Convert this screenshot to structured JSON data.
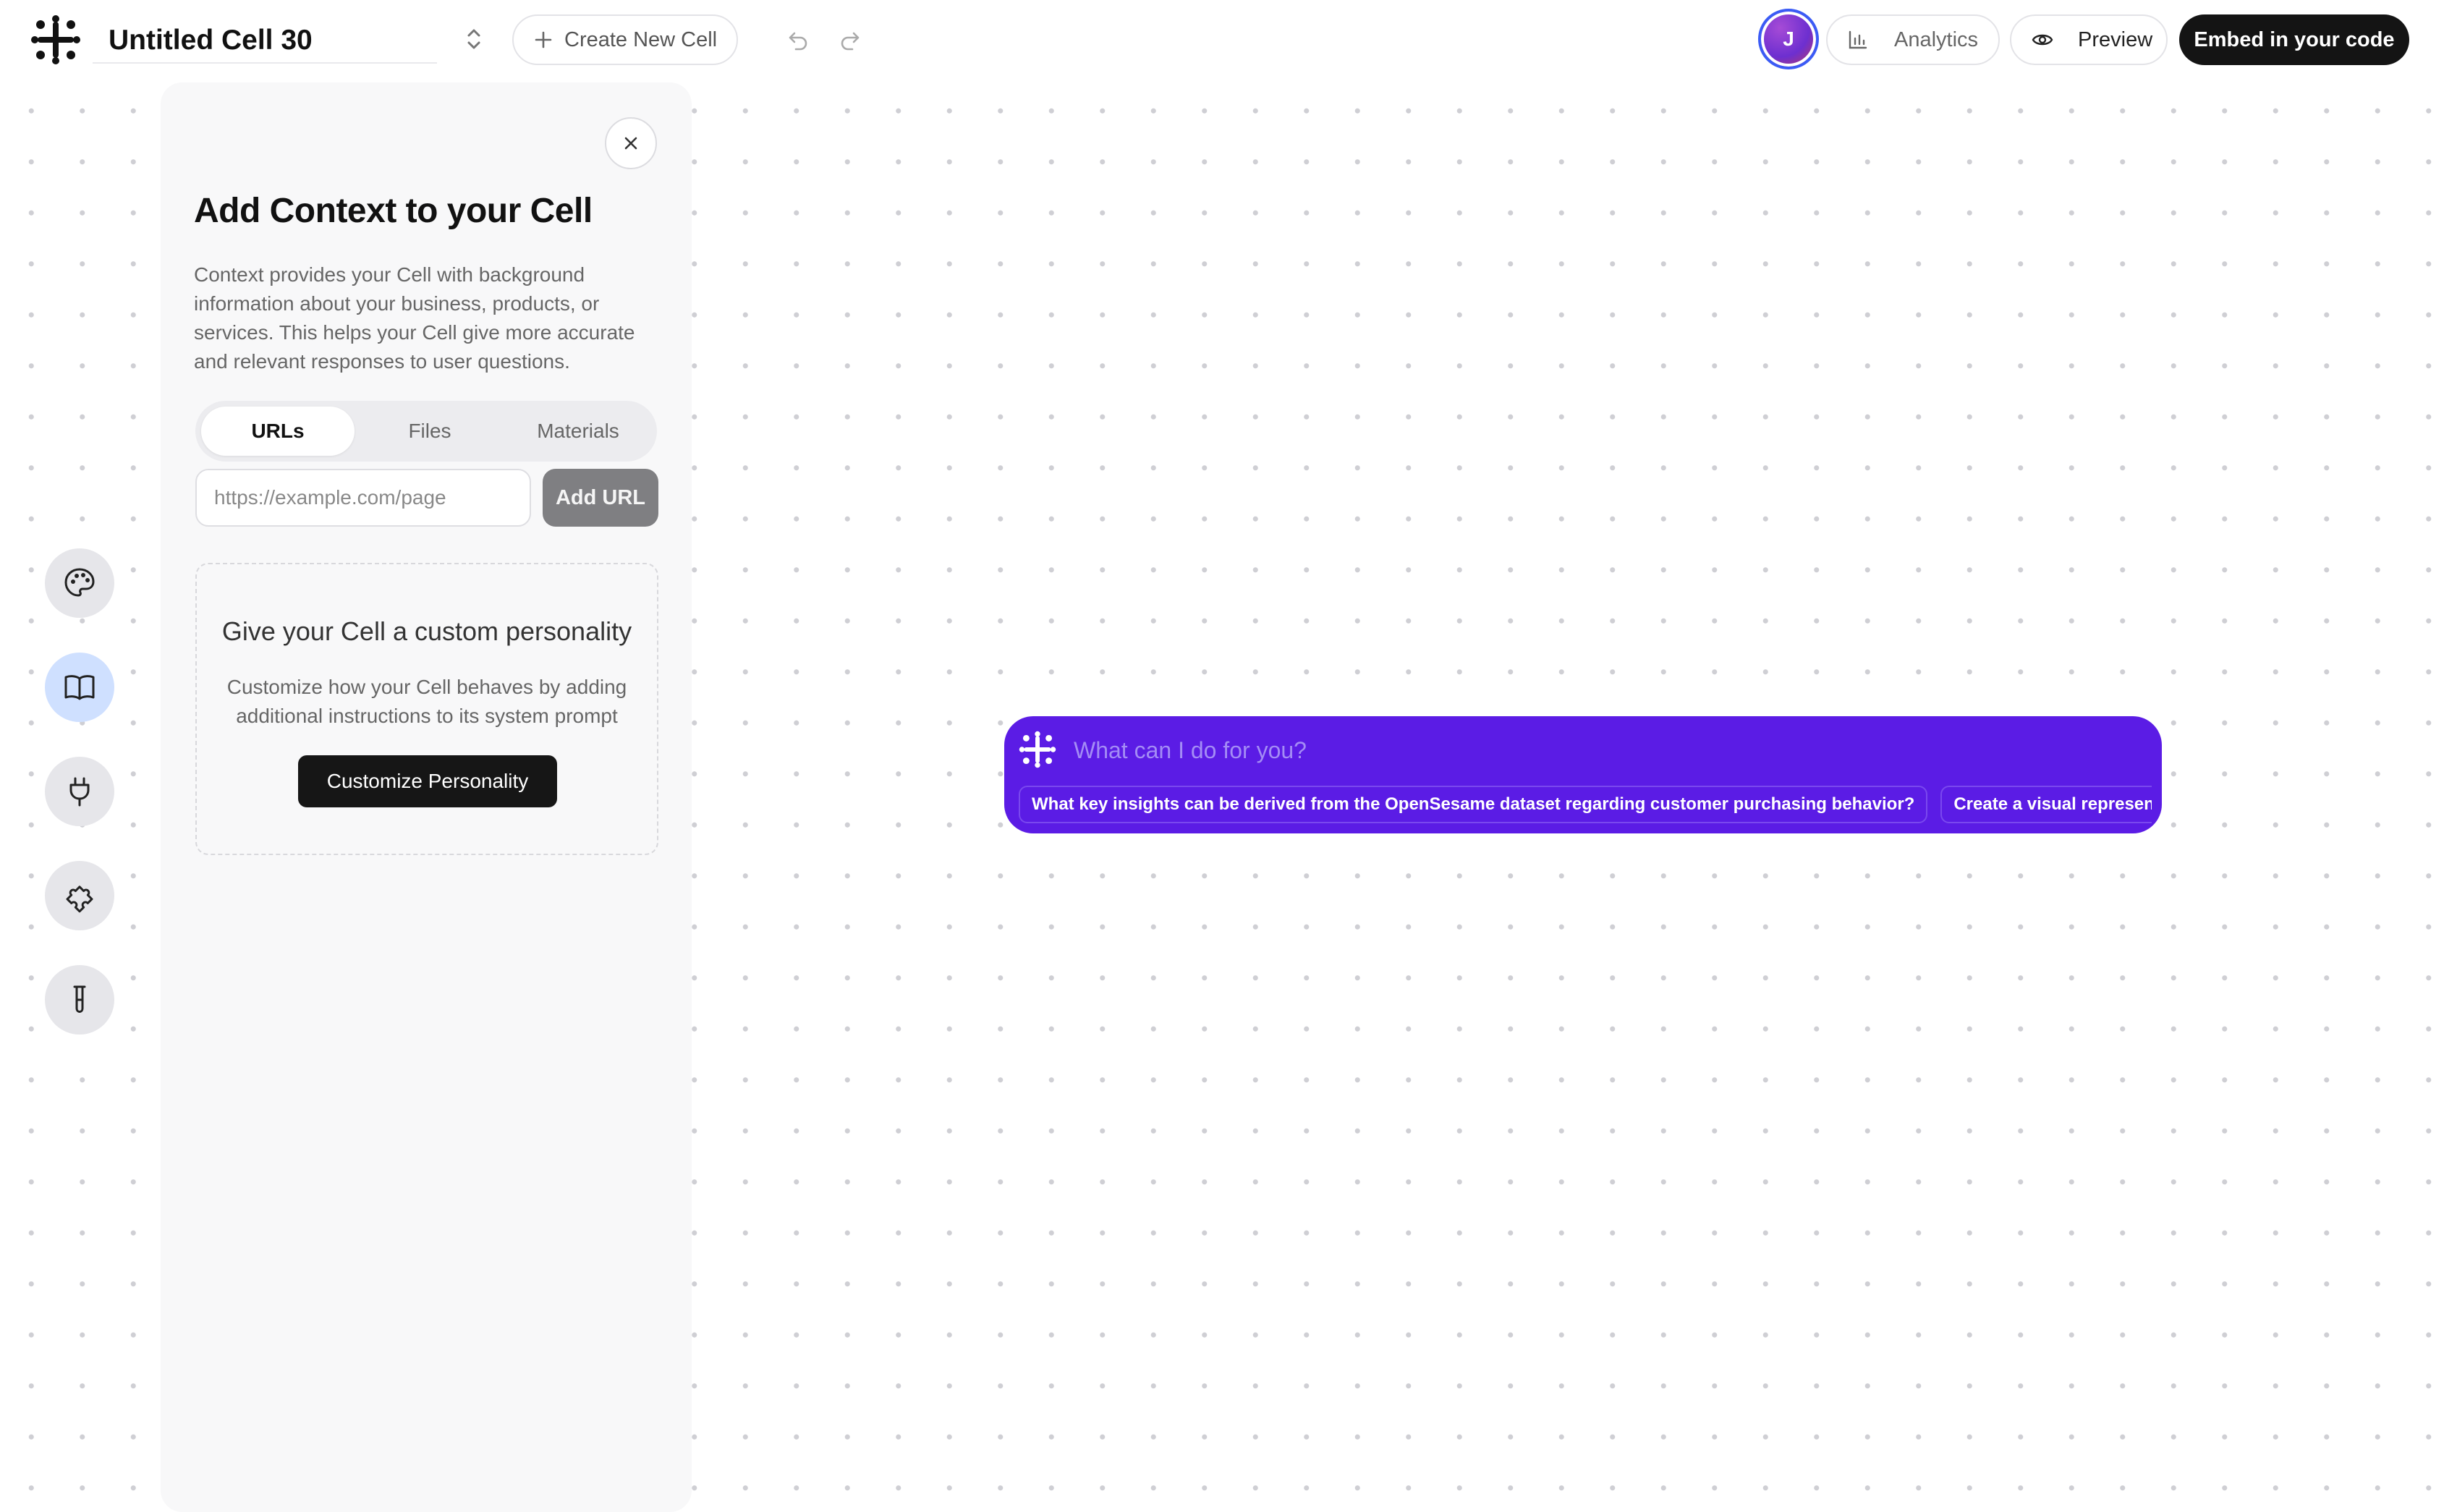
{
  "header": {
    "cell_title": "Untitled Cell 30",
    "create_label": "Create New Cell",
    "avatar_initial": "J",
    "analytics_label": "Analytics",
    "preview_label": "Preview",
    "embed_label": "Embed in your code"
  },
  "rail": {
    "items": [
      {
        "icon": "palette-icon"
      },
      {
        "icon": "book-icon",
        "active": true
      },
      {
        "icon": "plug-icon"
      },
      {
        "icon": "puzzle-icon"
      },
      {
        "icon": "test-tube-icon"
      }
    ]
  },
  "panel": {
    "title": "Add Context to your Cell",
    "description": "Context provides your Cell with background information about your business, products, or services. This helps your Cell give more accurate and relevant responses to user questions.",
    "tabs": [
      "URLs",
      "Files",
      "Materials"
    ],
    "active_tab": "URLs",
    "url_placeholder": "https://example.com/page",
    "add_url_label": "Add URL",
    "personality": {
      "title": "Give your Cell a custom personality",
      "description": "Customize how your Cell behaves by adding additional instructions to its system prompt",
      "button_label": "Customize Personality"
    }
  },
  "chat": {
    "placeholder": "What can I do for you?",
    "suggestions": [
      "What key insights can be derived from the OpenSesame dataset regarding customer purchasing behavior?",
      "Create a visual representatio"
    ]
  },
  "colors": {
    "accent": "#5b1ce5",
    "active_rail": "#cfe0ff",
    "dark_button": "#141414"
  }
}
